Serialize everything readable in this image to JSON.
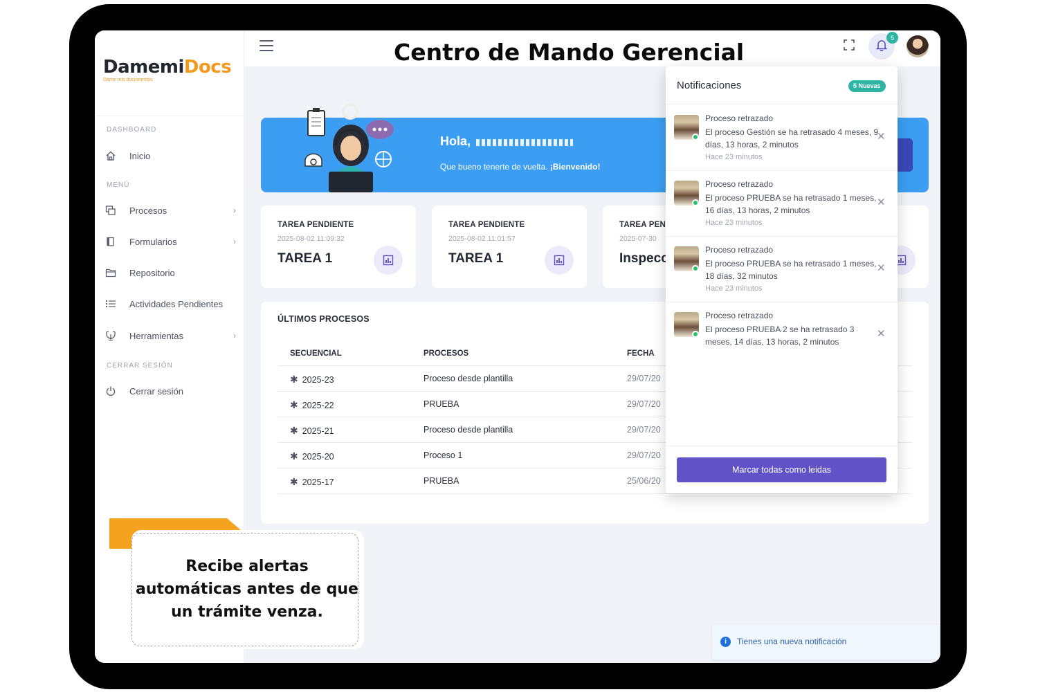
{
  "header": {
    "title": "Centro de Mando Gerencial",
    "notification_count": "5"
  },
  "brand": {
    "name_part1": "Damemi",
    "name_part2": "Docs",
    "tagline": "Dame mis documentos"
  },
  "sidebar": {
    "section_dashboard": "DASHBOARD",
    "section_menu": "MENÚ",
    "section_logout": "CERRAR SESIÓN",
    "items": [
      {
        "label": "Inicio",
        "icon": "home-icon"
      },
      {
        "label": "Procesos",
        "icon": "copy-icon",
        "has_submenu": true
      },
      {
        "label": "Formularios",
        "icon": "book-icon",
        "has_submenu": true
      },
      {
        "label": "Repositorio",
        "icon": "folder-icon"
      },
      {
        "label": "Actividades Pendientes",
        "icon": "list-icon"
      },
      {
        "label": "Herramientas",
        "icon": "tools-icon",
        "has_submenu": true
      },
      {
        "label": "Cerrar sesión",
        "icon": "power-icon"
      }
    ]
  },
  "banner": {
    "greeting": "Hola,",
    "subtitle": "Que bueno tenerte de vuelta.",
    "welcome": "¡Bienvenido!"
  },
  "cards": [
    {
      "label": "TAREA PENDIENTE",
      "date": "2025-08-02 11:09:32",
      "value": "TAREA 1"
    },
    {
      "label": "TAREA PENDIENTE",
      "date": "2025-08-02 11:01:57",
      "value": "TAREA 1"
    },
    {
      "label": "TAREA PEN",
      "date": "2025-07-30",
      "value": "Inspecc"
    }
  ],
  "processes": {
    "title": "ÚLTIMOS PROCESOS",
    "columns": [
      "SECUENCIAL",
      "PROCESOS",
      "FECHA"
    ],
    "rows": [
      {
        "seq": "2025-23",
        "name": "Proceso desde plantilla",
        "date": "29/07/20"
      },
      {
        "seq": "2025-22",
        "name": "PRUEBA",
        "date": "29/07/20"
      },
      {
        "seq": "2025-21",
        "name": "Proceso desde plantilla",
        "date": "29/07/20"
      },
      {
        "seq": "2025-20",
        "name": "Proceso 1",
        "date": "29/07/20"
      },
      {
        "seq": "2025-17",
        "name": "PRUEBA",
        "date": "25/06/20"
      }
    ]
  },
  "notifications": {
    "title": "Notificaciones",
    "badge": "5 Nuevas",
    "items": [
      {
        "title": "Proceso retrazado",
        "message": "El proceso Gestión se ha retrasado 4 meses, 9 días, 13 horas, 2 minutos",
        "time": "Hace 23 minutos"
      },
      {
        "title": "Proceso retrazado",
        "message": "El proceso PRUEBA se ha retrasado 1 meses, 16 días, 13 horas, 2 minutos",
        "time": "Hace 23 minutos"
      },
      {
        "title": "Proceso retrazado",
        "message": "El proceso PRUEBA se ha retrasado 1 meses, 18 días, 32 minutos",
        "time": "Hace 23 minutos"
      },
      {
        "title": "Proceso retrazado",
        "message": "El proceso PRUEBA 2 se ha retrasado 3 meses, 14 días, 13 horas, 2 minutos",
        "time": ""
      }
    ],
    "mark_all_label": "Marcar todas como leidas"
  },
  "toast": {
    "text": "Tienes una nueva notificación",
    "icon": "info-icon"
  },
  "callout": {
    "text": "Recibe alertas automáticas antes de que un trámite venza."
  },
  "colors": {
    "accent": "#6252c8",
    "banner": "#3b9ef2",
    "brand_orange": "#f39a1e",
    "badge_teal": "#2eb4a2"
  }
}
